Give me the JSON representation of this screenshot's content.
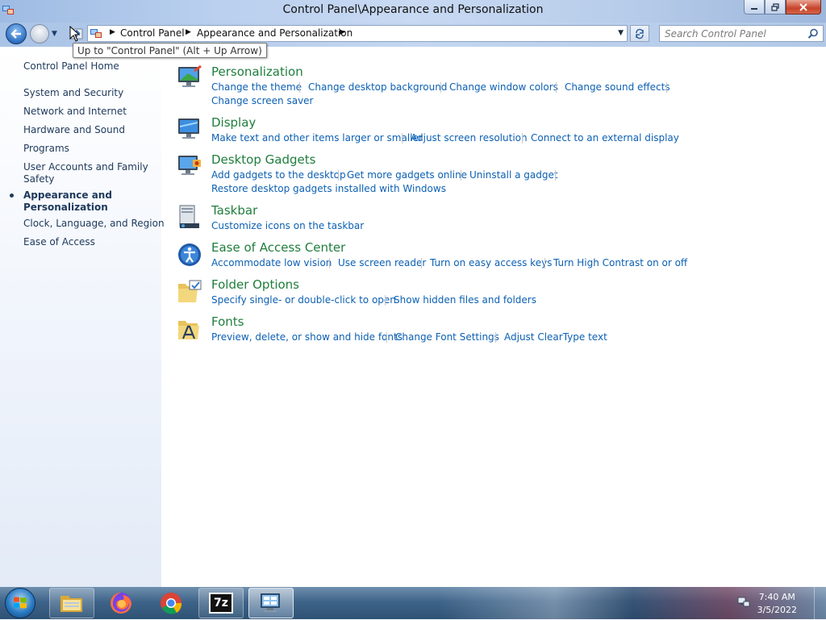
{
  "window": {
    "title": "Control Panel\\Appearance and Personalization"
  },
  "nav": {
    "breadcrumbs": [
      "Control Panel",
      "Appearance and Personalization"
    ],
    "search_placeholder": "Search Control Panel",
    "tooltip": "Up to \"Control Panel\" (Alt + Up Arrow)"
  },
  "sidebar": {
    "items": [
      {
        "label": "Control Panel Home"
      },
      {
        "label": "System and Security"
      },
      {
        "label": "Network and Internet"
      },
      {
        "label": "Hardware and Sound"
      },
      {
        "label": "Programs"
      },
      {
        "label": "User Accounts and Family",
        "label2": "Safety"
      },
      {
        "label": "Appearance and",
        "label2": "Personalization",
        "active": true
      },
      {
        "label": "Clock, Language, and Region"
      },
      {
        "label": "Ease of Access"
      }
    ]
  },
  "categories": [
    {
      "title": "Personalization",
      "icon": "personalization-icon",
      "links": [
        "Change the theme",
        "Change desktop background",
        "Change window colors",
        "Change sound effects",
        "Change screen saver"
      ]
    },
    {
      "title": "Display",
      "icon": "display-icon",
      "links": [
        "Make text and other items larger or smaller",
        "Adjust screen resolution",
        "Connect to an external display"
      ]
    },
    {
      "title": "Desktop Gadgets",
      "icon": "gadgets-icon",
      "links": [
        "Add gadgets to the desktop",
        "Get more gadgets online",
        "Uninstall a gadget",
        "Restore desktop gadgets installed with Windows"
      ]
    },
    {
      "title": "Taskbar",
      "icon": "taskbar-icon",
      "links": [
        "Customize icons on the taskbar"
      ]
    },
    {
      "title": "Ease of Access Center",
      "icon": "ease-of-access-icon",
      "links": [
        "Accommodate low vision",
        "Use screen reader",
        "Turn on easy access keys",
        "Turn High Contrast on or off"
      ]
    },
    {
      "title": "Folder Options",
      "icon": "folder-options-icon",
      "links": [
        "Specify single- or double-click to open",
        "Show hidden files and folders"
      ]
    },
    {
      "title": "Fonts",
      "icon": "fonts-icon",
      "links": [
        "Preview, delete, or show and hide fonts",
        "Change Font Settings",
        "Adjust ClearType text"
      ]
    }
  ],
  "taskbar": {
    "app_7zip_label": "7z",
    "time": "7:40 AM",
    "date": "3/5/2022"
  },
  "colors": {
    "category_title": "#1f7e3c",
    "link": "#0c60b3",
    "sidebar_text": "#1e395b"
  }
}
